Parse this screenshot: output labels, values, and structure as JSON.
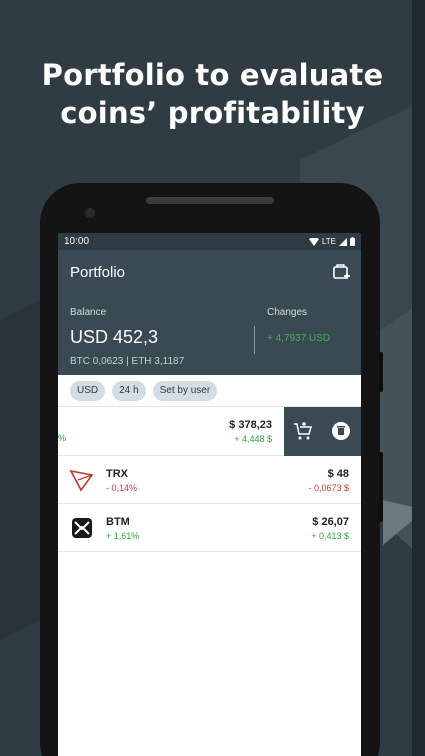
{
  "headline": {
    "line1": "Portfolio to evaluate",
    "line2": "coins’ profitability"
  },
  "status_bar": {
    "time": "10:00",
    "network": "LTE",
    "icons": [
      "wifi-icon",
      "signal-icon",
      "battery-icon"
    ]
  },
  "app": {
    "title": "Portfolio",
    "add_wallet_icon": "wallet-add-icon",
    "balance": {
      "label": "Balance",
      "value": "USD 452,3",
      "sub": "BTC 0,0623 | ETH 3,1187"
    },
    "changes": {
      "label": "Changes",
      "value": "+ 4,7937 USD"
    }
  },
  "filters": [
    "USD",
    "24 h",
    "Set by user"
  ],
  "swiped_row": {
    "left_fragment": "%",
    "value": "$ 378,23",
    "change": "+ 4,448 $",
    "actions": [
      "cart-add-icon",
      "delete-icon"
    ]
  },
  "coins": [
    {
      "symbol": "TRX",
      "pct": "- 0,14%",
      "value": "$ 48",
      "change": "- 0,0673 $",
      "trend": "down",
      "icon": "tron-logo-icon"
    },
    {
      "symbol": "BTM",
      "pct": "+ 1,61%",
      "value": "$ 26,07",
      "change": "+ 0,413 $",
      "trend": "up",
      "icon": "bytom-logo-icon"
    }
  ],
  "colors": {
    "background": "#2f3c43",
    "appbar": "#3a4a52",
    "positive": "#2fa244",
    "negative": "#d23a3a",
    "chip": "#d3dde3"
  }
}
